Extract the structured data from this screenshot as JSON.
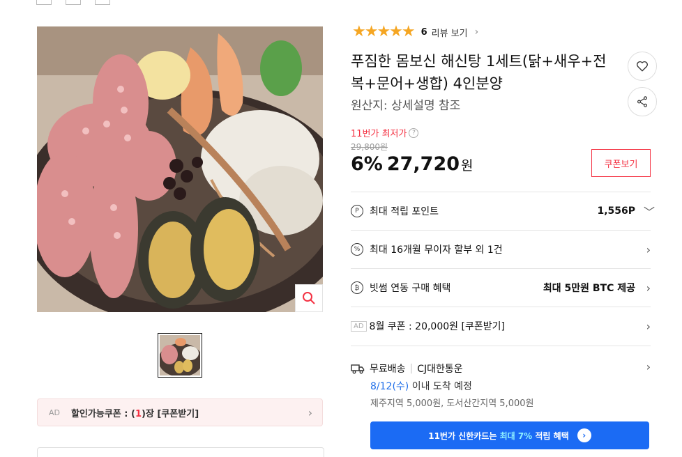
{
  "product": {
    "rating_stars": "★★★★★",
    "review_count": "6",
    "review_label": "리뷰 보기",
    "title": "푸짐한 몸보신 해신탕 1세트(닭+새우+전복+문어+생합) 4인분양",
    "origin": "원산지:  상세설명 참조"
  },
  "price": {
    "lowest_label": "11번가 최저가",
    "original": "29,800원",
    "discount": "6%",
    "value": "27,720",
    "unit": "원",
    "coupon_button": "쿠폰보기"
  },
  "benefits": [
    {
      "icon": "P",
      "label": "최대 적립 포인트",
      "value": "1,556P",
      "chevron": "﹀"
    },
    {
      "icon": "%",
      "label": "최대 16개월 무이자 할부 외 1건",
      "value": "",
      "chevron": "›"
    },
    {
      "icon": "₿",
      "label": "빗썸 연동 구매 혜택",
      "value": "최대 5만원 BTC 제공",
      "chevron": "›"
    },
    {
      "icon": "",
      "label": "8월 쿠폰 : 20,000원 [쿠폰받기]",
      "value": "",
      "chevron": "›",
      "ad": "AD"
    }
  ],
  "delivery": {
    "type": "무료배송",
    "courier": "CJ대한통운",
    "date": "8/12(수)",
    "date_suffix": " 이내 도착 예정",
    "extra_fee": "제주지역 5,000원, 도서산간지역 5,000원"
  },
  "card_banner": {
    "prefix": "11번가 신한카드는 ",
    "highlight": "최대 7%",
    "suffix": " 적립 혜택"
  },
  "left_coupon": {
    "ad": "AD",
    "label": "할인가능쿠폰 : (",
    "count": "1",
    "suffix": ")장 [쿠폰받기]"
  }
}
